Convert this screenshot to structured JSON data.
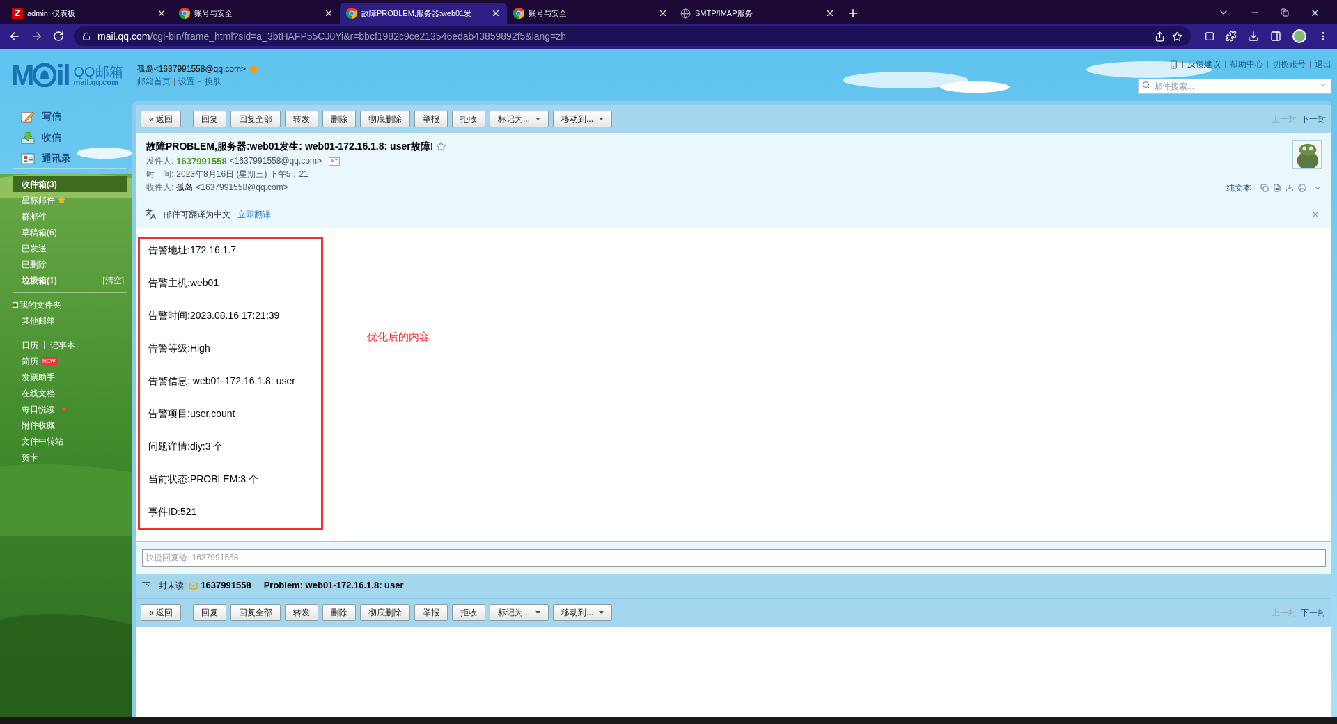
{
  "browser": {
    "tabs": [
      {
        "title": "admin: 仪表板",
        "kind": "z",
        "selected": false
      },
      {
        "title": "账号与安全",
        "kind": "chrome",
        "selected": false
      },
      {
        "title": "故障PROBLEM,服务器:web01发",
        "kind": "chrome",
        "selected": true
      },
      {
        "title": "账号与安全",
        "kind": "chrome",
        "selected": false
      },
      {
        "title": "SMTP/IMAP服务",
        "kind": "globe",
        "selected": false
      }
    ],
    "url_host": "mail.qq.com",
    "url_path": "/cgi-bin/frame_html?sid=a_3btHAFP55CJ0Yi&r=bbcf1982c9ce213546edab43859892f5&lang=zh"
  },
  "header": {
    "logo": {
      "left": "M",
      "right": "il",
      "name": "QQ邮箱",
      "domain": "mail.qq.com"
    },
    "account": "孤岛<1637991558@qq.com>",
    "account_links": [
      "邮箱首页",
      "设置",
      "换肤"
    ],
    "top_links": [
      "反馈建议",
      "帮助中心",
      "切换账号",
      "退出"
    ],
    "search": {
      "placeholder": "邮件搜索..."
    }
  },
  "sidebar": {
    "actions": [
      {
        "label": "写信",
        "kind": "write"
      },
      {
        "label": "收信",
        "kind": "receive"
      },
      {
        "label": "通讯录",
        "kind": "contacts"
      }
    ],
    "folders": [
      {
        "label": "收件箱(3)",
        "selected": true,
        "unread": true
      },
      {
        "label": "星标邮件",
        "selected": false,
        "unread": false,
        "starred": true
      },
      {
        "label": "群邮件",
        "selected": false,
        "unread": false
      },
      {
        "label": "草稿箱(6)",
        "selected": false,
        "unread": false
      },
      {
        "label": "已发送",
        "selected": false,
        "unread": false
      },
      {
        "label": "已删除",
        "selected": false,
        "unread": false
      },
      {
        "label": "垃圾箱(1)",
        "selected": false,
        "unread": true,
        "action": "[清空]"
      }
    ],
    "my_folders": {
      "label": "我的文件夹",
      "expanded": false
    },
    "other_mail": "其他邮箱",
    "tools_row": [
      "日历",
      "记事本"
    ],
    "tools": [
      {
        "label": "简历",
        "badge": "NEW"
      },
      {
        "label": "发票助手"
      },
      {
        "label": "在线文档"
      },
      {
        "label": "每日悦读",
        "dot": true
      },
      {
        "label": "附件收藏"
      },
      {
        "label": "文件中转站"
      },
      {
        "label": "贺卡"
      }
    ]
  },
  "top_toolbar": {
    "buttons": [
      {
        "label": "« 返回",
        "kind": "back"
      },
      {
        "label": "回复",
        "kind": "plain"
      },
      {
        "label": "回复全部",
        "kind": "plain"
      },
      {
        "label": "转发",
        "kind": "plain"
      },
      {
        "label": "删除",
        "kind": "plain"
      },
      {
        "label": "彻底删除",
        "kind": "plain"
      },
      {
        "label": "举报",
        "kind": "plain"
      },
      {
        "label": "拒收",
        "kind": "plain"
      },
      {
        "label": "标记为...",
        "kind": "dropdown"
      },
      {
        "label": "移动到...",
        "kind": "dropdown"
      }
    ],
    "nav": [
      {
        "label": "上一封",
        "disabled": true
      },
      {
        "label": "下一封",
        "disabled": false
      }
    ]
  },
  "mail": {
    "subject": "故障PROBLEM,服务器:web01发生: web01-172.16.1.8: user故障!",
    "starred": false,
    "from_label": "发件人:",
    "from_name": "1637991558",
    "from_addr": "<1637991558@qq.com>",
    "time_label": "时　间:",
    "time": "2023年8月16日 (星期三) 下午5：21",
    "to_label": "收件人:",
    "to_name": "孤岛",
    "to_addr": "<1637991558@qq.com>",
    "plain_text": "纯文本"
  },
  "translate": {
    "text": "邮件可翻译为中文",
    "link": "立即翻译"
  },
  "body": {
    "lines": [
      "告警地址:172.16.1.7",
      "告警主机:web01",
      "告警时间:2023.08.16 17:21:39",
      "告警等级:High",
      "告警信息: web01-172.16.1.8: user",
      "告警项目:user.count",
      "问题详情:diy:3 个",
      "当前状态:PROBLEM:3 个",
      "事件ID:521"
    ],
    "annotation": "优化后的内容"
  },
  "quick_reply": {
    "placeholder": "快捷回复给: 1637991558"
  },
  "next_unread": {
    "label": "下一封未读:",
    "sender": "1637991558",
    "subject": "Problem: web01-172.16.1.8: user"
  },
  "bottom_toolbar": {
    "buttons": [
      {
        "label": "« 返回",
        "kind": "back"
      },
      {
        "label": "回复",
        "kind": "plain"
      },
      {
        "label": "回复全部",
        "kind": "plain"
      },
      {
        "label": "转发",
        "kind": "plain"
      },
      {
        "label": "删除",
        "kind": "plain"
      },
      {
        "label": "彻底删除",
        "kind": "plain"
      },
      {
        "label": "举报",
        "kind": "plain"
      },
      {
        "label": "拒收",
        "kind": "plain"
      },
      {
        "label": "标记为...",
        "kind": "dropdown"
      },
      {
        "label": "移动到...",
        "kind": "dropdown"
      }
    ],
    "nav": [
      {
        "label": "上一封",
        "disabled": true
      },
      {
        "label": "下一封",
        "disabled": false
      }
    ]
  }
}
